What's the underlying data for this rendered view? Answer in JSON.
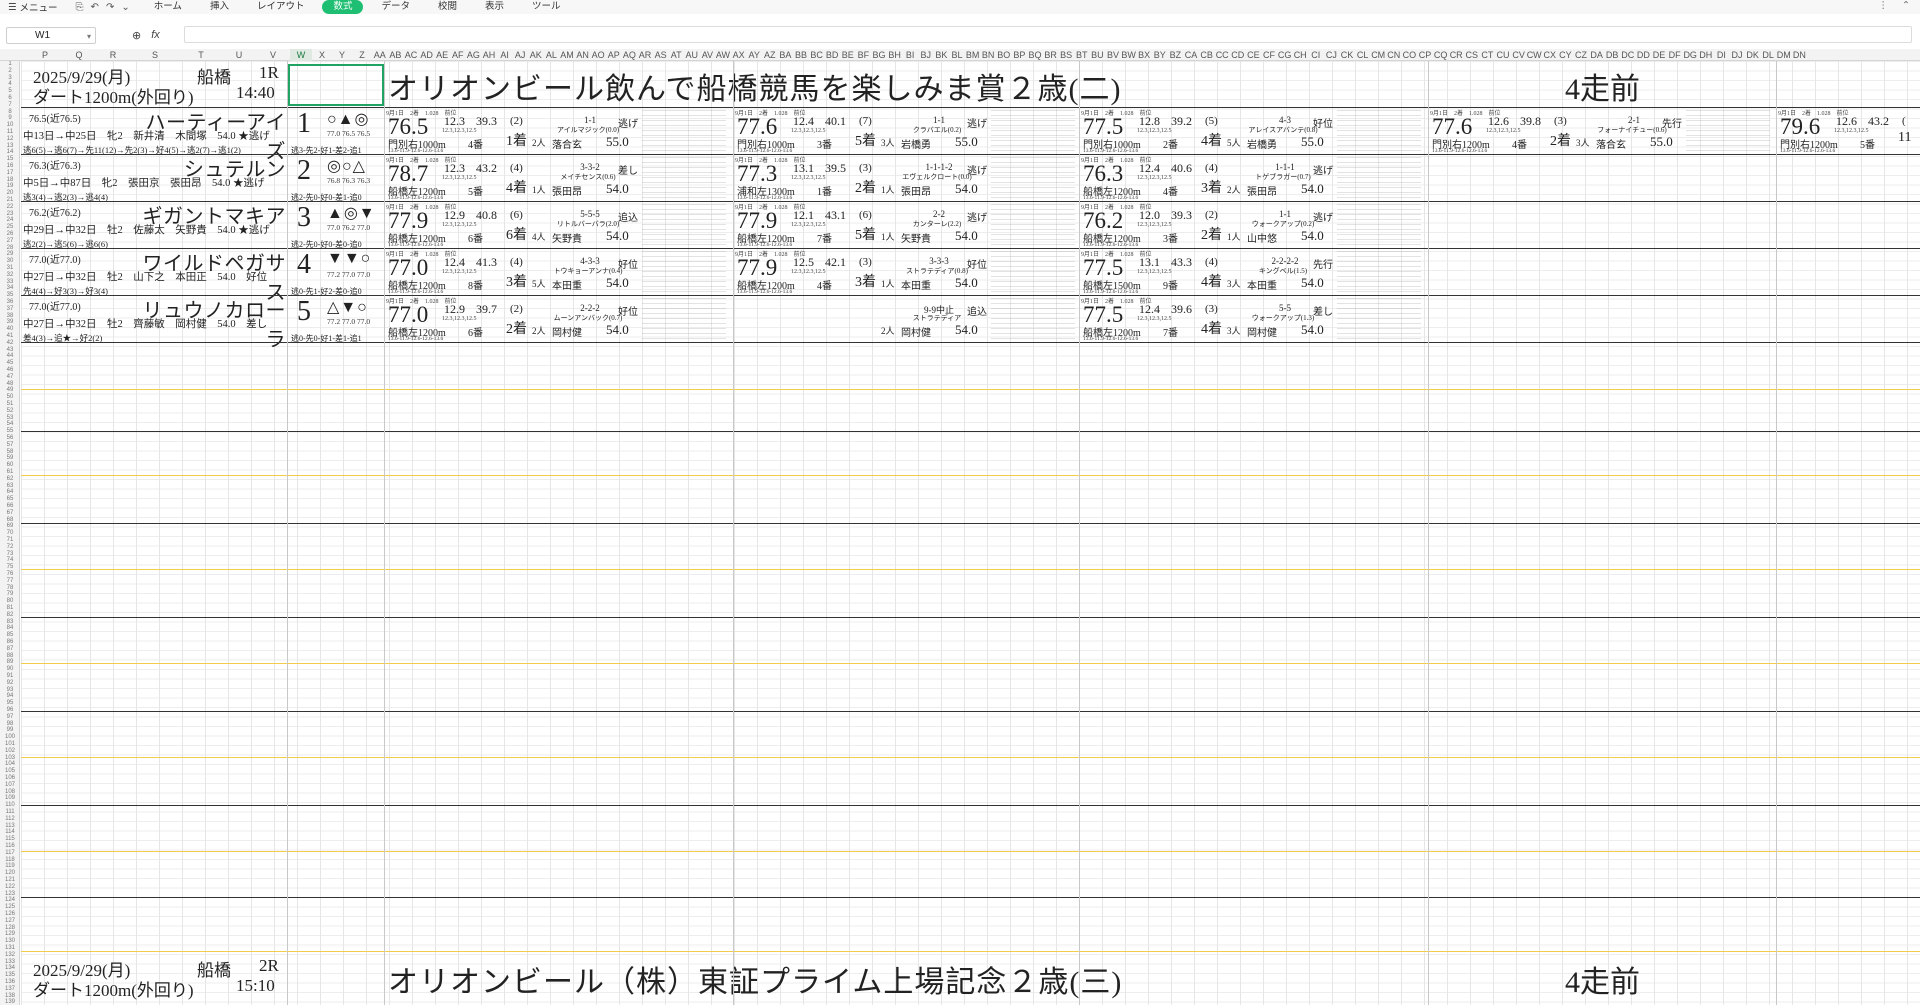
{
  "toolbar": {
    "menu_label": "メニュー",
    "tabs": [
      "ホーム",
      "挿入",
      "レイアウト",
      "数式",
      "データ",
      "校閲",
      "表示",
      "ツール"
    ],
    "active_tab": "数式"
  },
  "formula_bar": {
    "name_box": "W1",
    "fx": "fx",
    "value": ""
  },
  "columns": [
    "P",
    "Q",
    "R",
    "S",
    "T",
    "U",
    "V",
    "W",
    "X",
    "Y",
    "Z",
    "AA",
    "AB",
    "AC",
    "AD",
    "AE",
    "AF",
    "AG",
    "AH",
    "AI",
    "AJ",
    "AK",
    "AL",
    "AM",
    "AN",
    "AO",
    "AP",
    "AQ",
    "AR",
    "AS",
    "AT",
    "AU",
    "AV",
    "AW",
    "AX",
    "AY",
    "AZ",
    "BA",
    "BB",
    "BC",
    "BD",
    "BE",
    "BF",
    "BG",
    "BH",
    "BI",
    "BJ",
    "BK",
    "BL",
    "BM",
    "BN",
    "BO",
    "BP",
    "BQ",
    "BR",
    "BS",
    "BT",
    "BU",
    "BV",
    "BW",
    "BX",
    "BY",
    "BZ",
    "CA",
    "CB",
    "CC",
    "CD",
    "CE",
    "CF",
    "CG",
    "CH",
    "CI",
    "CJ",
    "CK",
    "CL",
    "CM",
    "CN",
    "CO",
    "CP",
    "CQ",
    "CR",
    "CS",
    "CT",
    "CU",
    "CV",
    "CW",
    "CX",
    "CY",
    "CZ",
    "DA",
    "DB",
    "DC",
    "DD",
    "DE",
    "DF",
    "DG",
    "DH",
    "DI",
    "DJ",
    "DK",
    "DL",
    "DM",
    "DN"
  ],
  "selected_column": "W",
  "races": [
    {
      "date": "2025/9/29(月)",
      "place": "船橋",
      "race_no": "1R",
      "course": "ダート1200m(外回り)",
      "time": "14:40",
      "title": "オリオンビール飲んで船橋競馬を楽しみま賞２歳(二)",
      "prev_label": "4走前"
    },
    {
      "date": "2025/9/29(月)",
      "place": "船橋",
      "race_no": "2R",
      "course": "ダート1200m(外回り)",
      "time": "15:10",
      "title": "オリオンビール（株）東証プライム上場記念２歳(三)",
      "prev_label": "4走前"
    }
  ],
  "horses": [
    {
      "rating": "76.5(近76.5)",
      "name": "ハーティーアイズ",
      "info": "中13日→中25日　牝2　新井清　木間塚　54.0 ★逃げ",
      "positions": "逃6(5)→逃6(7)→先11(12)→先2(3)→好4(5)→逃2(7)→逃1(2)",
      "number": "1",
      "marks": "○▲◎",
      "mini": "77.0 76.5 76.5",
      "trial": "逃3-先2-好1-差2-追1",
      "runs": [
        {
          "idx": "76.5",
          "n1": "12.3",
          "n2": "39.3",
          "pop": "(2)",
          "course": "門別右1000m",
          "gate": "4番",
          "rank": "1着",
          "corner": "1-1",
          "winner": "アイルマジック(0.0)",
          "field": "2人",
          "jockey": "落合玄",
          "weight": "55.0",
          "style": "逃げ"
        },
        {
          "idx": "77.6",
          "n1": "12.4",
          "n2": "40.1",
          "pop": "(7)",
          "course": "門別右1000m",
          "gate": "3番",
          "rank": "5着",
          "corner": "1-1",
          "winner": "クラバエル(0.2)",
          "field": "3人",
          "jockey": "岩橋勇",
          "weight": "55.0",
          "style": "逃げ"
        },
        {
          "idx": "77.5",
          "n1": "12.8",
          "n2": "39.2",
          "pop": "(5)",
          "course": "門別右1000m",
          "gate": "2番",
          "rank": "4着",
          "corner": "4-3",
          "winner": "アレイスアバンテ(0.8)",
          "field": "5人",
          "jockey": "岩橋勇",
          "weight": "55.0",
          "style": "好位"
        },
        {
          "idx": "77.6",
          "n1": "12.6",
          "n2": "39.8",
          "pop": "(3)",
          "course": "門別右1200m",
          "gate": "4番",
          "rank": "2着",
          "corner": "2-1",
          "winner": "フォーナイチュー(0.6)",
          "field": "3人",
          "jockey": "落合玄",
          "weight": "55.0",
          "style": "先行"
        },
        {
          "idx": "79.6",
          "n1": "12.6",
          "n2": "43.2",
          "pop": "(",
          "course": "門別右1200m",
          "gate": "5番",
          "rank": "11",
          "corner": "",
          "winner": "",
          "field": "",
          "jockey": "",
          "weight": "",
          "style": ""
        }
      ]
    },
    {
      "rating": "76.3(近76.3)",
      "name": "シュテルン",
      "info": "中5日→中87日　牝2　張田京　張田昂　54.0 ★逃げ",
      "positions": "逃3(4)→逃2(3)→逃4(4)",
      "number": "2",
      "marks": "◎○△",
      "mini": "76.8 76.3 76.3",
      "trial": "逃2-先0-好0-差1-追0",
      "runs": [
        {
          "idx": "78.7",
          "n1": "12.3",
          "n2": "43.2",
          "pop": "(4)",
          "course": "船橋左1200m",
          "gate": "5番",
          "rank": "4着",
          "corner": "3-3-2",
          "winner": "メイチセンス(0.6)",
          "field": "1人",
          "jockey": "張田昂",
          "weight": "54.0",
          "style": "差し"
        },
        {
          "idx": "77.3",
          "n1": "13.1",
          "n2": "39.5",
          "pop": "(3)",
          "course": "浦和左1300m",
          "gate": "1番",
          "rank": "2着",
          "corner": "1-1-1-2",
          "winner": "エヴェルクロート(0.0)",
          "field": "1人",
          "jockey": "張田昂",
          "weight": "54.0",
          "style": "逃げ"
        },
        {
          "idx": "76.3",
          "n1": "12.4",
          "n2": "40.6",
          "pop": "(4)",
          "course": "船橋左1200m",
          "gate": "4番",
          "rank": "3着",
          "corner": "1-1-1",
          "winner": "トゲブラガー(0.7)",
          "field": "2人",
          "jockey": "張田昂",
          "weight": "54.0",
          "style": "逃げ"
        }
      ]
    },
    {
      "rating": "76.2(近76.2)",
      "name": "ギガントマキア",
      "info": "中29日→中32日　牡2　佐藤太　矢野貴　54.0 ★逃げ",
      "positions": "逃2(2)→逃5(6)→逃6(6)",
      "number": "3",
      "marks": "▲◎▼",
      "mini": "77.0 76.2 77.0",
      "trial": "逃2-先0-好0-差0-追0",
      "runs": [
        {
          "idx": "77.9",
          "n1": "12.9",
          "n2": "40.8",
          "pop": "(6)",
          "course": "船橋左1200m",
          "gate": "6番",
          "rank": "6着",
          "corner": "5-5-5",
          "winner": "リトルバーバラ(2.0)",
          "field": "4人",
          "jockey": "矢野貴",
          "weight": "54.0",
          "style": "追込"
        },
        {
          "idx": "77.9",
          "n1": "12.1",
          "n2": "43.1",
          "pop": "(6)",
          "course": "船橋左1200m",
          "gate": "7番",
          "rank": "5着",
          "corner": "2-2",
          "winner": "カンターレ(2.2)",
          "field": "1人",
          "jockey": "矢野貴",
          "weight": "54.0",
          "style": "逃げ"
        },
        {
          "idx": "76.2",
          "n1": "12.0",
          "n2": "39.3",
          "pop": "(2)",
          "course": "船橋左1200m",
          "gate": "3番",
          "rank": "2着",
          "corner": "1-1",
          "winner": "ウォークアップ(0.2)",
          "field": "1人",
          "jockey": "山中悠",
          "weight": "54.0",
          "style": "逃げ"
        }
      ]
    },
    {
      "rating": "77.0(近77.0)",
      "name": "ワイルドペガサス",
      "info": "中27日→中32日　牡2　山下之　本田正　54.0　好位",
      "positions": "先4(4)→好3(3)→好3(4)",
      "number": "4",
      "marks": "▼▼○",
      "mini": "77.2 77.0 77.0",
      "trial": "逃0-先1-好2-差0-追0",
      "runs": [
        {
          "idx": "77.0",
          "n1": "12.4",
          "n2": "41.3",
          "pop": "(4)",
          "course": "船橋左1200m",
          "gate": "8番",
          "rank": "3着",
          "corner": "4-3-3",
          "winner": "トウキョーアンナ(0.4)",
          "field": "5人",
          "jockey": "本田重",
          "weight": "54.0",
          "style": "好位"
        },
        {
          "idx": "77.9",
          "n1": "12.5",
          "n2": "42.1",
          "pop": "(3)",
          "course": "船橋左1200m",
          "gate": "4番",
          "rank": "3着",
          "corner": "3-3-3",
          "winner": "ストラテディア(0.8)",
          "field": "1人",
          "jockey": "本田重",
          "weight": "54.0",
          "style": "好位"
        },
        {
          "idx": "77.5",
          "n1": "13.1",
          "n2": "43.3",
          "pop": "(4)",
          "course": "船橋左1500m",
          "gate": "9番",
          "rank": "4着",
          "corner": "2-2-2-2",
          "winner": "キングベル(1.5)",
          "field": "3人",
          "jockey": "本田重",
          "weight": "54.0",
          "style": "先行"
        }
      ]
    },
    {
      "rating": "77.0(近77.0)",
      "name": "リュウノカローラ",
      "info": "中27日→中32日　牡2　齊藤敏　岡村健　54.0　差し",
      "positions": "差4(3)→追★→好2(2)",
      "number": "5",
      "marks": "△▼○",
      "mini": "77.2 77.0 77.0",
      "trial": "逃0-先0-好1-差1-追1",
      "runs": [
        {
          "idx": "77.0",
          "n1": "12.9",
          "n2": "39.7",
          "pop": "(2)",
          "course": "船橋左1200m",
          "gate": "6番",
          "rank": "2着",
          "corner": "2-2-2",
          "winner": "ムーンアンバック(0.7)",
          "field": "2人",
          "jockey": "岡村健",
          "weight": "54.0",
          "style": "好位"
        },
        {
          "idx": "",
          "n1": "",
          "n2": "",
          "pop": "",
          "course": "",
          "gate": "",
          "rank": "",
          "corner": "9-9中止",
          "winner": "ストラテディア",
          "field": "2人",
          "jockey": "岡村健",
          "weight": "54.0",
          "style": "追込"
        },
        {
          "idx": "77.5",
          "n1": "12.4",
          "n2": "39.6",
          "pop": "(3)",
          "course": "船橋左1200m",
          "gate": "7番",
          "rank": "4着",
          "corner": "5-5",
          "winner": "ウォークアップ(1.3)",
          "field": "3人",
          "jockey": "岡村健",
          "weight": "54.0",
          "style": "差し"
        }
      ]
    }
  ],
  "run_meta": "9月1日　2着　1.028　前位",
  "run_lap": "12.3,12.3,12.5",
  "run_bottom": "13.6-11.9-12.6-12.6-13.6",
  "row_numbers_start": 1,
  "row_numbers_count": 140
}
